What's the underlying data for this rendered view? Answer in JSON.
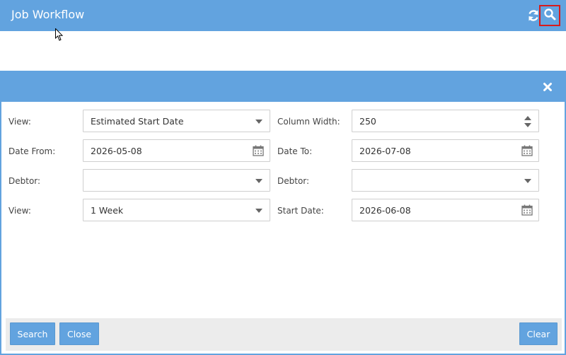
{
  "header": {
    "title": "Job Workflow"
  },
  "icons": {
    "refresh": "refresh-icon",
    "search": "search-icon",
    "close": "close-icon",
    "calendar": "calendar-icon"
  },
  "form": {
    "view1": {
      "label": "View:",
      "value": "Estimated Start Date"
    },
    "column_width": {
      "label": "Column Width:",
      "value": "250"
    },
    "date_from": {
      "label": "Date From:",
      "value": "2026-05-08"
    },
    "date_to": {
      "label": "Date To:",
      "value": "2026-07-08"
    },
    "debtor1": {
      "label": "Debtor:",
      "value": ""
    },
    "debtor2": {
      "label": "Debtor:",
      "value": ""
    },
    "view2": {
      "label": "View:",
      "value": "1 Week"
    },
    "start_date": {
      "label": "Start Date:",
      "value": "2026-06-08"
    }
  },
  "buttons": {
    "search": "Search",
    "close": "Close",
    "clear": "Clear"
  },
  "colors": {
    "primary": "#62a3df",
    "highlight": "#d81b1b",
    "footer": "#ececec"
  }
}
